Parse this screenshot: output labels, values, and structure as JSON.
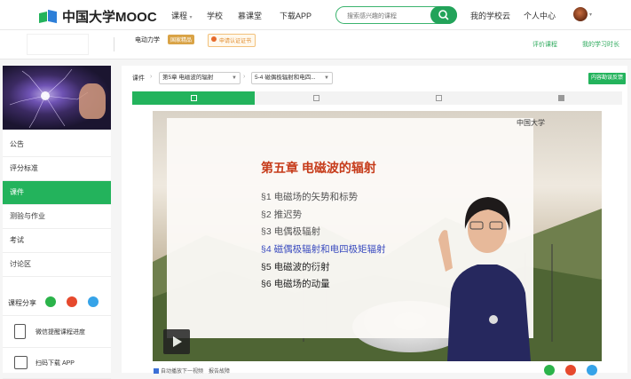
{
  "header": {
    "brand": "中国大学MOOC",
    "nav": [
      "课程",
      "学校",
      "慕课堂",
      "下载APP"
    ],
    "search_placeholder": "搜索感兴趣的课程",
    "my_school": "我的学校云",
    "personal_center": "个人中心",
    "colors": {
      "brand": "#23b35c",
      "brand_dark": "#23a35a"
    }
  },
  "course_bar": {
    "course_name": "电动力学",
    "badge_national": "国家精品",
    "badge_certificate": "申请认证证书",
    "rate_course": "评价课程",
    "my_study_time": "我的学习时长"
  },
  "sidebar": {
    "items": [
      "公告",
      "评分标准",
      "课件",
      "测验与作业",
      "考试",
      "讨论区"
    ],
    "active_index": 2,
    "share_label": "课程分享",
    "promo1": "微信提醒课程进度",
    "promo2": "扫码下载 APP"
  },
  "main": {
    "crumb_label": "课件",
    "chapter_select": "第5章 电磁波的辐射",
    "section_select": "5-4 磁偶极辐射和电四...",
    "feedback_button": "内容勘误反馈",
    "tabs": [
      "video",
      "doc",
      "video",
      "discussion"
    ],
    "video": {
      "logo_text": "中国大学",
      "slide_title": "第五章  电磁波的辐射",
      "items": [
        "§1  电磁场的矢势和标势",
        "§2  推迟势",
        "§3  电偶极辐射",
        "§4  磁偶极辐射和电四极矩辐射",
        "§5  电磁波的衍射",
        "§6  电磁场的动量"
      ]
    },
    "autoplay_label": "自动播放下一视频",
    "report_label": "报告故障"
  }
}
